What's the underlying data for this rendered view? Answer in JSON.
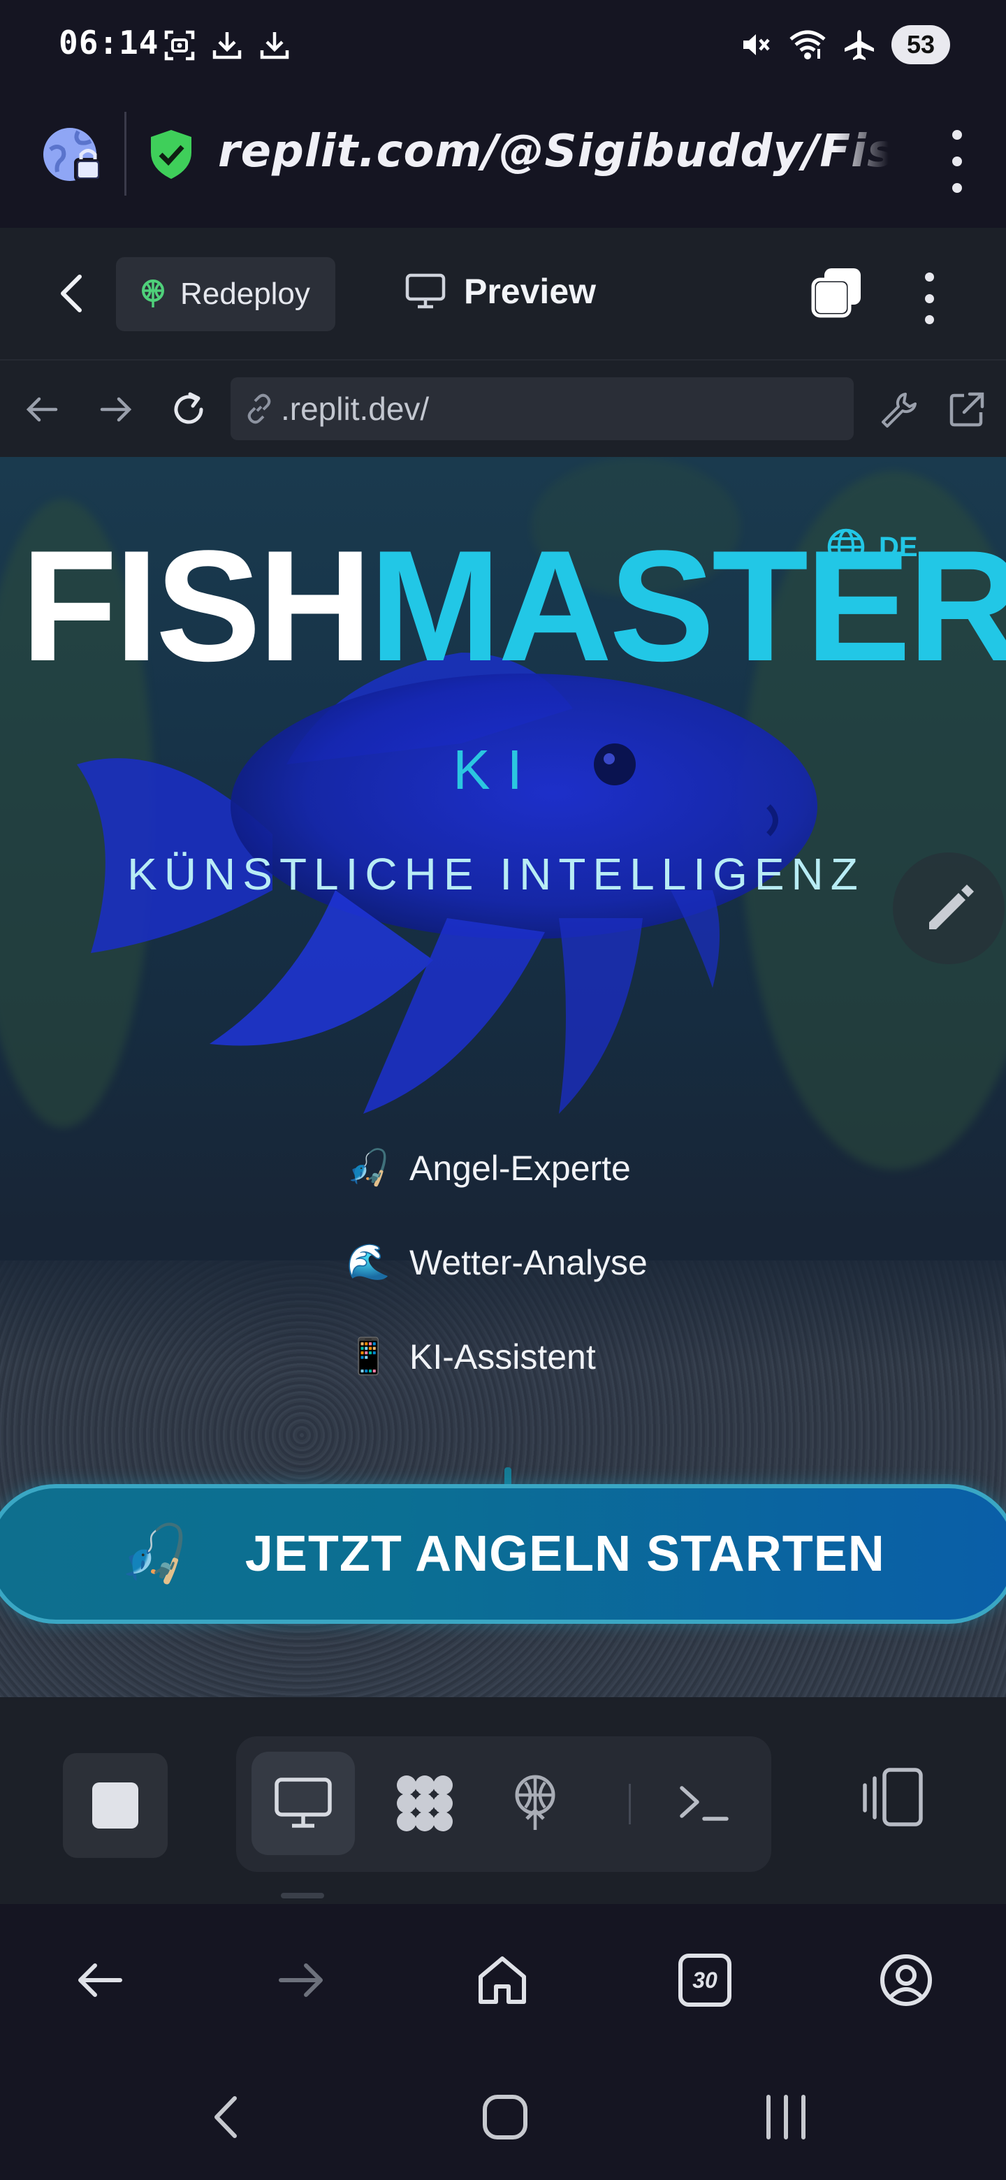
{
  "status_bar": {
    "time": "06:14",
    "battery": "53"
  },
  "browser": {
    "url": "replit.com/@Sigibuddy/Fish/"
  },
  "replit_header": {
    "redeploy_label": "Redeploy",
    "preview_label": "Preview"
  },
  "webview": {
    "url": ".replit.dev/"
  },
  "hero": {
    "brand_fish": "FISH",
    "brand_master": "MASTER",
    "language": "DE",
    "ki": "KI",
    "tagline": "KÜNSTLICHE INTELLIGENZ",
    "features": [
      {
        "emoji": "🎣",
        "label": "Angel-Experte"
      },
      {
        "emoji": "🌊",
        "label": "Wetter-Analyse"
      },
      {
        "emoji": "📱",
        "label": "KI-Assistent"
      }
    ],
    "cta": {
      "emoji": "🎣",
      "label": "JETZT ANGELN STARTEN"
    }
  },
  "browser_nav": {
    "tab_count": "30"
  },
  "icons": {
    "status_left": [
      "screenshot-icon",
      "download-icon",
      "download-icon"
    ],
    "status_right": [
      "mute-icon",
      "wifi-icon",
      "airplane-icon",
      "battery-icon"
    ],
    "replit_toolbar": [
      "stop-icon",
      "monitor-icon",
      "apps-icon",
      "deploy-icon",
      "terminal-icon",
      "split-view-icon"
    ]
  },
  "colors": {
    "accent_cyan": "#22c7e6",
    "cta_blue": "#0a5ea8",
    "secure_green": "#3fcf5a",
    "redeploy_green": "#4fd07a"
  }
}
